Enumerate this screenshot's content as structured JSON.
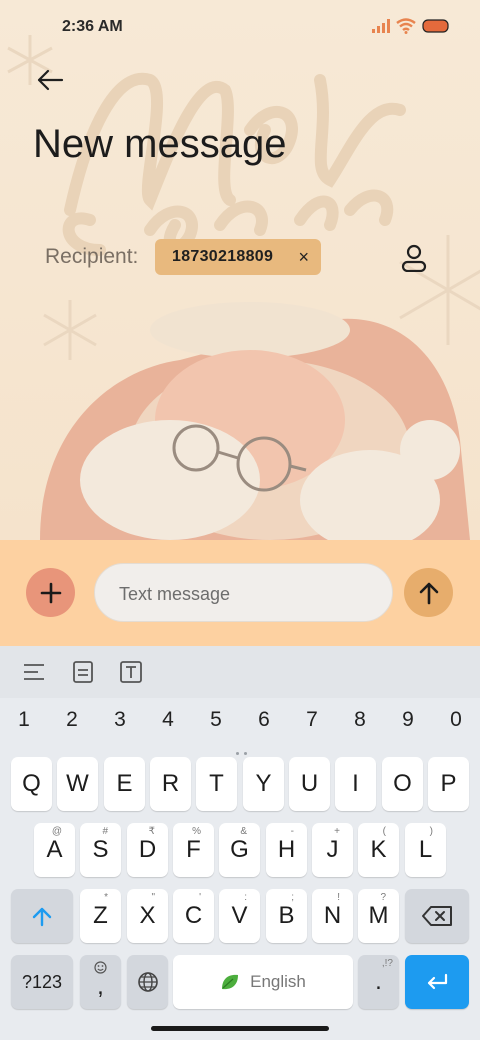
{
  "status_bar": {
    "time": "2:36 AM"
  },
  "header": {
    "title": "New message"
  },
  "recipient": {
    "label": "Recipient:",
    "number": "18730218809",
    "remove_symbol": "×"
  },
  "compose": {
    "placeholder": "Text message"
  },
  "keyboard": {
    "toolbar": [
      "text-align-icon",
      "clipboard-icon",
      "text-format-icon"
    ],
    "number_row": [
      "1",
      "2",
      "3",
      "4",
      "5",
      "6",
      "7",
      "8",
      "9",
      "0"
    ],
    "row1": [
      "Q",
      "W",
      "E",
      "R",
      "T",
      "Y",
      "U",
      "I",
      "O",
      "P"
    ],
    "row2": [
      {
        "key": "A",
        "hint": "@"
      },
      {
        "key": "S",
        "hint": "#"
      },
      {
        "key": "D",
        "hint": "₹"
      },
      {
        "key": "F",
        "hint": "%"
      },
      {
        "key": "G",
        "hint": "&"
      },
      {
        "key": "H",
        "hint": "-"
      },
      {
        "key": "J",
        "hint": "+"
      },
      {
        "key": "K",
        "hint": "("
      },
      {
        "key": "L",
        "hint": ")"
      }
    ],
    "row3": [
      {
        "key": "Z",
        "hint": "*"
      },
      {
        "key": "X",
        "hint": "\""
      },
      {
        "key": "C",
        "hint": "'"
      },
      {
        "key": "V",
        "hint": ":"
      },
      {
        "key": "B",
        "hint": ";"
      },
      {
        "key": "N",
        "hint": "!"
      },
      {
        "key": "M",
        "hint": "?"
      }
    ],
    "bottom": {
      "symbols_label": "?123",
      "comma": ",",
      "space_label": "English",
      "period": ".",
      "period_hint": ",!?"
    }
  },
  "colors": {
    "compose_bar": "#fdd1a1",
    "chip": "#e8b97e",
    "accent_blue": "#1d9bf0"
  }
}
